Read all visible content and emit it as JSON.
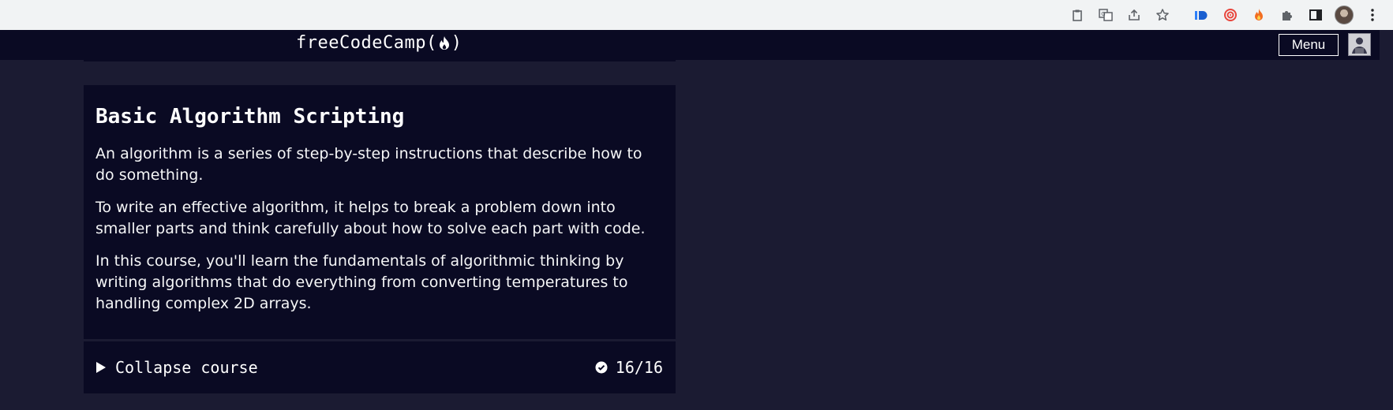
{
  "browser": {
    "toolbar_icons": [
      "clipboard-icon",
      "translate-icon",
      "share-icon",
      "bookmark-star-icon",
      "extension-id-icon",
      "extension-target-icon",
      "extension-fire-icon",
      "puzzle-icon",
      "side-panel-icon",
      "profile-avatar",
      "kebab-menu-icon"
    ]
  },
  "nav": {
    "logo_text": "freeCodeCamp(",
    "logo_text_end": ")",
    "menu_label": "Menu"
  },
  "course": {
    "title": "Basic Algorithm Scripting",
    "paragraphs": [
      "An algorithm is a series of step-by-step instructions that describe how to do something.",
      "To write an effective algorithm, it helps to break a problem down into smaller parts and think carefully about how to solve each part with code.",
      "In this course, you'll learn the fundamentals of algorithmic thinking by writing algorithms that do everything from converting temperatures to handling complex 2D arrays."
    ],
    "toggle_label": "Collapse course",
    "progress_text": "16/16",
    "completed": 16,
    "total": 16
  },
  "colors": {
    "page_bg": "#1b1b32",
    "card_bg": "#0a0a23",
    "text": "#ffffff",
    "chrome_bg": "#f1f3f4"
  }
}
